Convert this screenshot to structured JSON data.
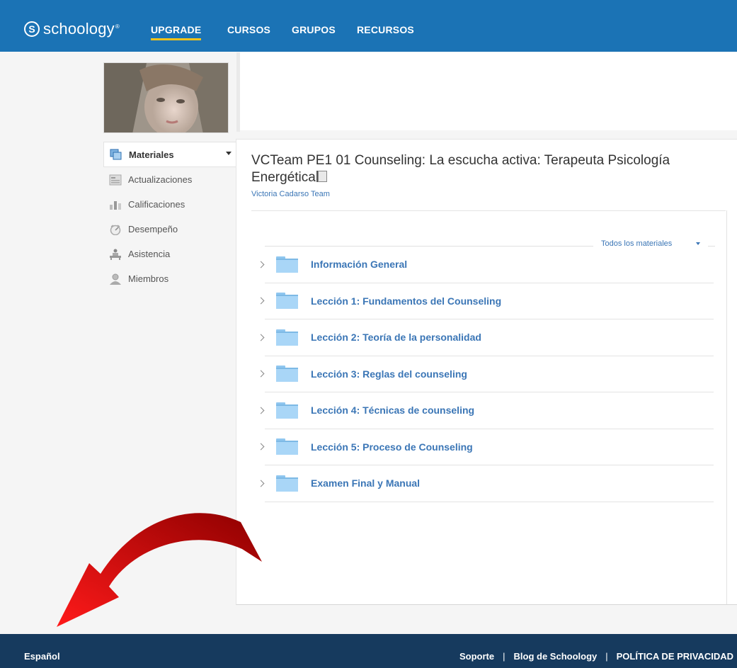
{
  "nav": {
    "logo": "schoology",
    "items": [
      {
        "label": "UPGRADE",
        "active": true
      },
      {
        "label": "CURSOS"
      },
      {
        "label": "GRUPOS"
      },
      {
        "label": "RECURSOS"
      }
    ]
  },
  "sidebar": {
    "items": [
      {
        "label": "Materiales",
        "icon": "materials-icon",
        "active": true
      },
      {
        "label": "Actualizaciones",
        "icon": "updates-icon"
      },
      {
        "label": "Calificaciones",
        "icon": "grades-icon"
      },
      {
        "label": "Desempeño",
        "icon": "performance-icon"
      },
      {
        "label": "Asistencia",
        "icon": "attendance-icon"
      },
      {
        "label": "Miembros",
        "icon": "members-icon"
      }
    ]
  },
  "course": {
    "title": "VCTeam PE1 01 Counseling: La escucha activa: Terapeuta Psicología Energética",
    "author": "Victoria Cadarso Team"
  },
  "filter": {
    "label": "Todos los materiales"
  },
  "folders": [
    "Información General",
    "Lección 1: Fundamentos del Counseling",
    "Lección 2: Teoría de la personalidad",
    "Lección 3: Reglas del counseling",
    "Lección 4: Técnicas de counseling",
    "Lección 5: Proceso de Counseling",
    "Examen Final y Manual"
  ],
  "footer": {
    "language": "Español",
    "links": [
      "Soporte",
      "Blog de Schoology",
      "POLÍTICA DE PRIVACIDAD"
    ],
    "separator": "|"
  },
  "colors": {
    "topbar": "#1b73b5",
    "accent": "#f6c21a",
    "link": "#3b76b6",
    "footer": "#163a5e",
    "arrow": "#c40000"
  }
}
